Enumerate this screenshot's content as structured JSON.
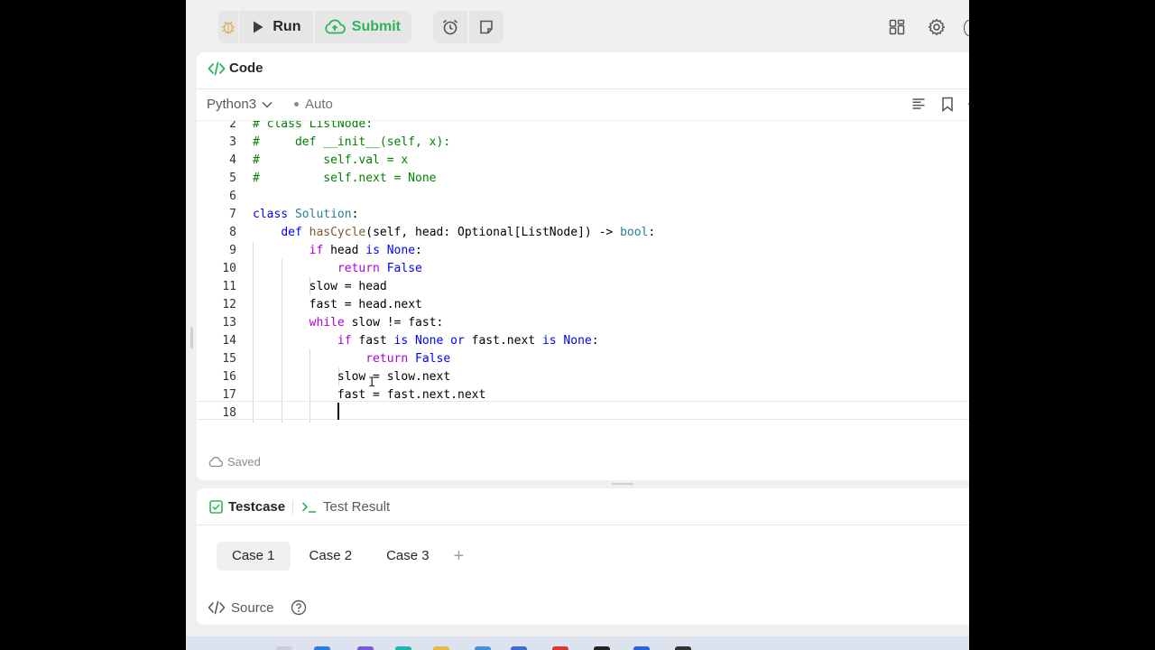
{
  "toolbar": {
    "run_label": "Run",
    "submit_label": "Submit",
    "accent_green": "#2db55d"
  },
  "code_panel": {
    "title": "Code",
    "language": "Python3",
    "mode": "Auto",
    "saved_status": "Saved"
  },
  "code_lines": [
    {
      "n": "2",
      "text": "# class ListNode:"
    },
    {
      "n": "3",
      "text": "#     def __init__(self, x):"
    },
    {
      "n": "4",
      "text": "#         self.val = x"
    },
    {
      "n": "5",
      "text": "#         self.next = None"
    },
    {
      "n": "6",
      "text": ""
    },
    {
      "n": "7",
      "text": "class Solution:"
    },
    {
      "n": "8",
      "text": "    def hasCycle(self, head: Optional[ListNode]) -> bool:"
    },
    {
      "n": "9",
      "text": "        if head is None:"
    },
    {
      "n": "10",
      "text": "            return False"
    },
    {
      "n": "11",
      "text": "        slow = head"
    },
    {
      "n": "12",
      "text": "        fast = head.next"
    },
    {
      "n": "13",
      "text": "        while slow != fast:"
    },
    {
      "n": "14",
      "text": "            if fast is None or fast.next is None:"
    },
    {
      "n": "15",
      "text": "                return False"
    },
    {
      "n": "16",
      "text": "            slow = slow.next"
    },
    {
      "n": "17",
      "text": "            fast = fast.next.next"
    },
    {
      "n": "18",
      "text": ""
    }
  ],
  "test_panel": {
    "testcase_tab": "Testcase",
    "result_tab": "Test Result",
    "cases": [
      "Case 1",
      "Case 2",
      "Case 3"
    ],
    "add_case": "+",
    "source_label": "Source"
  }
}
